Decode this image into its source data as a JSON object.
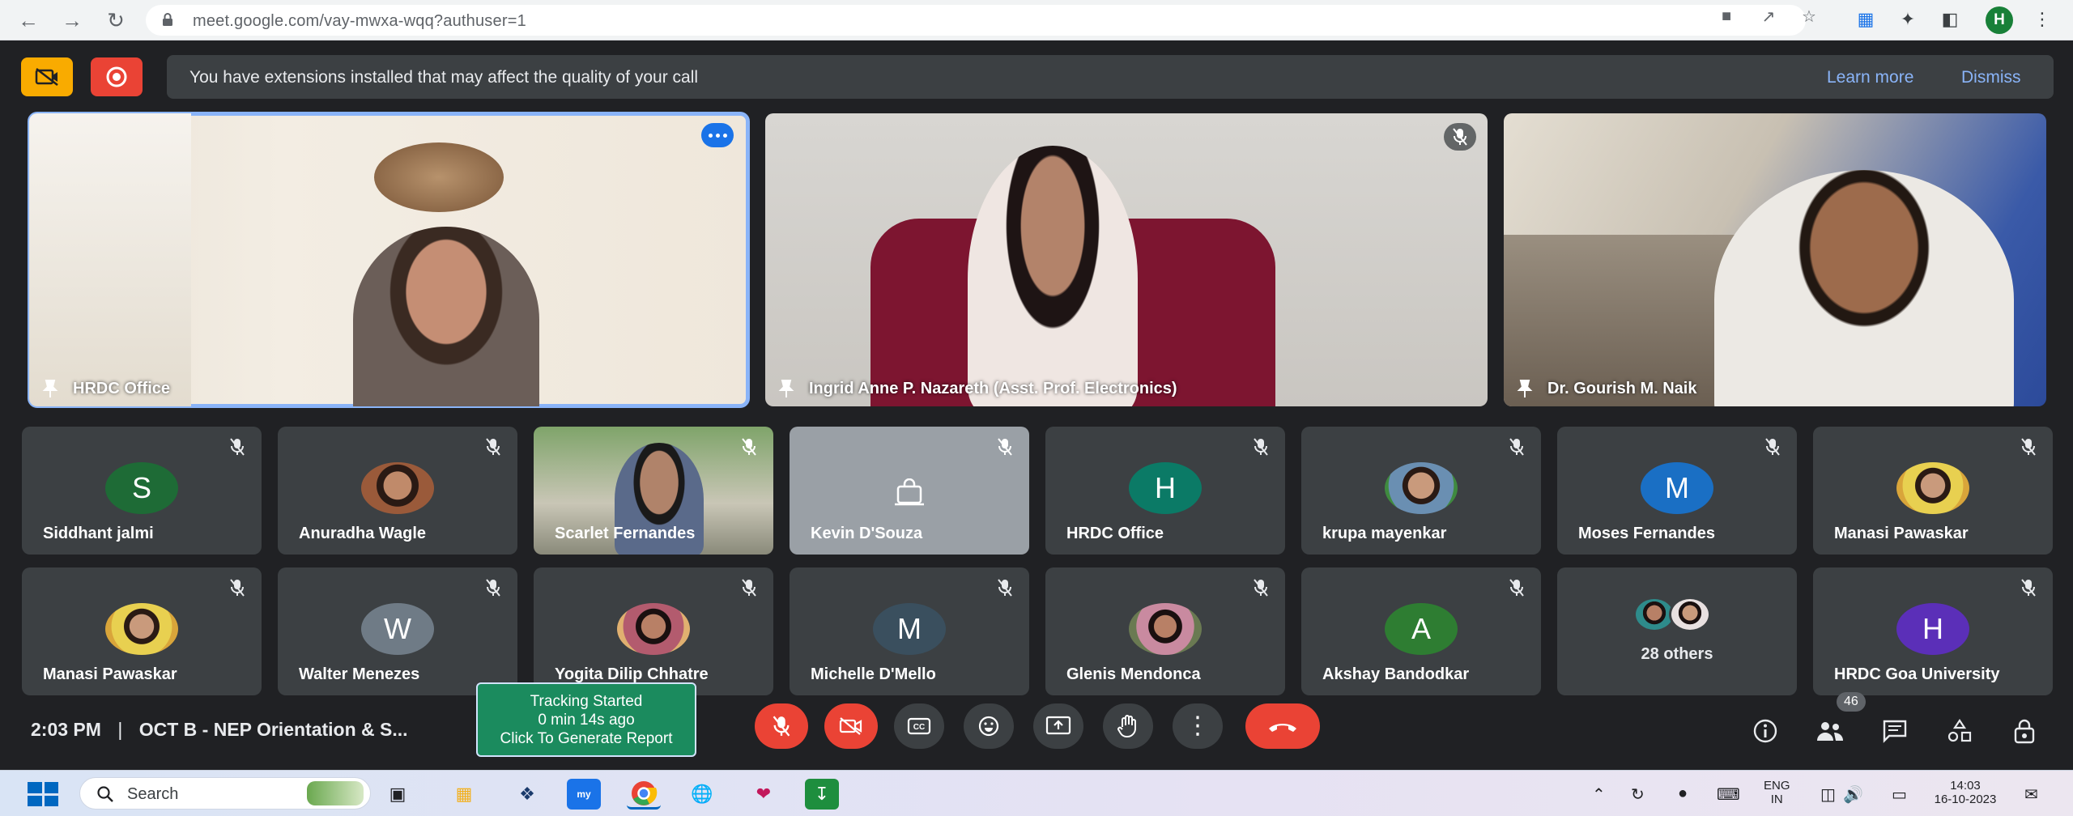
{
  "browser": {
    "url": "meet.google.com/vay-mwxa-wqq?authuser=1",
    "profile_initial": "H"
  },
  "banner": {
    "message": "You have extensions installed that may affect the quality of your call",
    "learn_more": "Learn more",
    "dismiss": "Dismiss"
  },
  "featured": [
    {
      "name": "HRDC Office"
    },
    {
      "name": "Ingrid Anne P. Nazareth (Asst. Prof. Electronics)"
    },
    {
      "name": "Dr. Gourish M. Naik"
    }
  ],
  "participants_row1": [
    {
      "name": "Siddhant jalmi",
      "initial": "S",
      "color": "#1e6b36"
    },
    {
      "name": "Anuradha Wagle",
      "initial": "",
      "color": "#9a5a3a"
    },
    {
      "name": "Scarlet Fernandes",
      "initial": "",
      "color": ""
    },
    {
      "name": "Kevin D'Souza",
      "initial": "",
      "color": ""
    },
    {
      "name": "HRDC Office",
      "initial": "H",
      "color": "#0b7a66"
    },
    {
      "name": "krupa mayenkar",
      "initial": "",
      "color": "#6a8fb2"
    },
    {
      "name": "Moses Fernandes",
      "initial": "M",
      "color": "#1a6fc4"
    },
    {
      "name": "Manasi Pawaskar",
      "initial": "",
      "color": "#d9a53a"
    }
  ],
  "participants_row2": [
    {
      "name": "Manasi Pawaskar",
      "initial": "",
      "color": "#d9a53a"
    },
    {
      "name": "Walter Menezes",
      "initial": "W",
      "color": "#6f7b86"
    },
    {
      "name": "Yogita Dilip Chhatre",
      "initial": "",
      "color": "#b35b6e"
    },
    {
      "name": "Michelle D'Mello",
      "initial": "M",
      "color": "#3a4f5e"
    },
    {
      "name": "Glenis Mendonca",
      "initial": "",
      "color": "#8a7a62"
    },
    {
      "name": "Akshay Bandodkar",
      "initial": "A",
      "color": "#2e7d32"
    },
    {
      "name": "28 others",
      "initial": "",
      "color": ""
    },
    {
      "name": "HRDC Goa University",
      "initial": "H",
      "color": "#5b2fb8"
    }
  ],
  "meeting": {
    "time": "2:03 PM",
    "separator": "|",
    "title": "OCT B - NEP Orientation & S...",
    "participant_count": "46"
  },
  "tracker": {
    "line1": "Tracking Started",
    "line2": "0 min 14s ago",
    "line3": "Click To Generate Report"
  },
  "taskbar": {
    "search_label": "Search",
    "lang_top": "ENG",
    "lang_bottom": "IN",
    "time": "14:03",
    "date": "16-10-2023"
  },
  "colors": {
    "meet_bg": "#202124",
    "tile_bg": "#3c4043",
    "danger": "#ea4335",
    "link": "#8ab4f8",
    "tracker_bg": "#1b8b5e"
  }
}
